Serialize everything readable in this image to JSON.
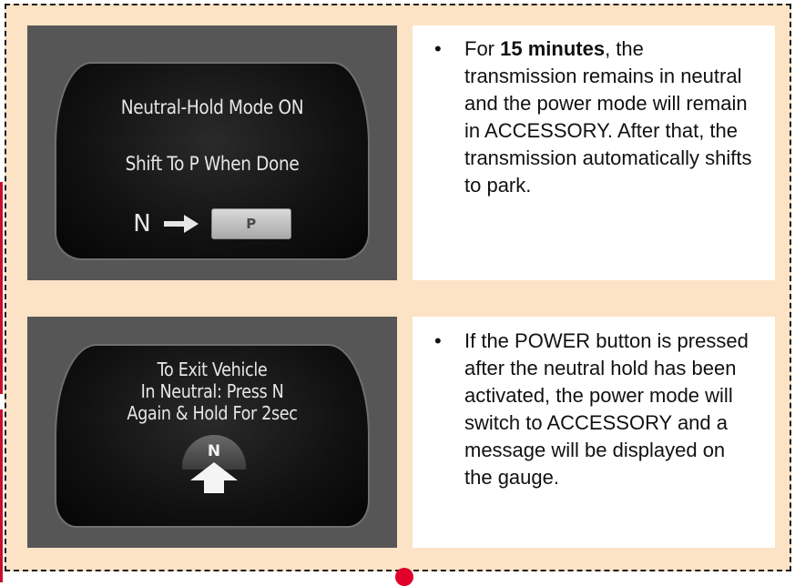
{
  "panel1": {
    "display_line1": "Neutral-Hold Mode ON",
    "display_line2": "Shift To P When Done",
    "shift_from": "N",
    "shift_to": "P",
    "bullet": "•",
    "text_prefix": "For",
    "text_bold": "15 minutes",
    "text_rest": ", the transmission remains in neutral and the power mode will remain in ACCESSORY. After that, the transmission automatically shifts to park."
  },
  "panel2": {
    "display_line1": "To Exit Vehicle",
    "display_line2": "In Neutral: Press N",
    "display_line3": "Again & Hold For 2sec",
    "gauge_label": "N",
    "bullet": "•",
    "text": "If the POWER button is pressed after the neutral hold has been activated, the power mode will switch to ACCESSORY and a message will be displayed on the gauge."
  },
  "icons": {
    "shift_arrow": "arrow-right-icon",
    "press_arrow": "up-arrow-icon"
  },
  "colors": {
    "background": "#fde3c6",
    "frame_border": "#1c1c1c",
    "accent_red": "#e0002a",
    "display_bezel": "#565656"
  }
}
